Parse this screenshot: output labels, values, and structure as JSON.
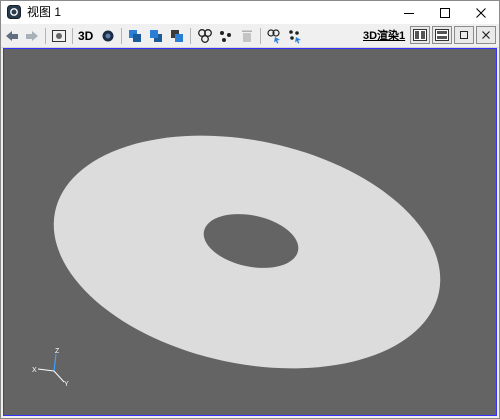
{
  "window": {
    "title": "视图 1",
    "icons": [
      "app-icon",
      "minimize-icon",
      "maximize-icon",
      "close-icon"
    ]
  },
  "toolbar": {
    "mode_label": "3D",
    "render_label": "3D渲染1",
    "icons": [
      "view-back-icon",
      "view-forward-icon",
      "fit-view-icon",
      "sphere-icon",
      "cube-front-icon",
      "cube-back-icon",
      "cube-stack-icon",
      "group-circles-icon",
      "scatter-dots-icon",
      "trash-icon",
      "select-group-icon",
      "select-dots-icon",
      "layout-split-vertical-icon",
      "layout-split-horizontal-icon",
      "restore-icon",
      "close-view-icon"
    ]
  },
  "viewport": {
    "background": "#646464",
    "shape_color": "#dcdcdc",
    "shape": "annulus (flat ring) viewed in perspective",
    "axis_labels": [
      "Z",
      "X",
      "Y"
    ]
  }
}
